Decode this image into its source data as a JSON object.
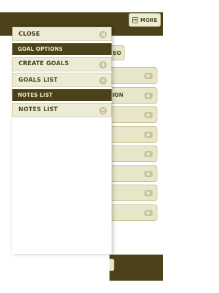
{
  "header": {
    "more_label": "MORE"
  },
  "background": {
    "tab_label": "EO",
    "rows": [
      {
        "text": ""
      },
      {
        "text": "ION"
      },
      {
        "text": ""
      },
      {
        "text": ""
      },
      {
        "text": ""
      },
      {
        "text": ""
      },
      {
        "text": ""
      },
      {
        "text": ""
      }
    ]
  },
  "menu": {
    "close_label": "CLOSE",
    "goal_options_heading": "GOAL OPTIONS",
    "create_goals_label": "CREATE GOALS",
    "goals_list_label": "GOALS LIST",
    "notes_list_heading": "NOTES LIST",
    "notes_list_label": "NOTES LIST"
  },
  "colors": {
    "dark": "#4b4219",
    "item_bg": "#ecebd6",
    "icon": "#c7c39f"
  }
}
